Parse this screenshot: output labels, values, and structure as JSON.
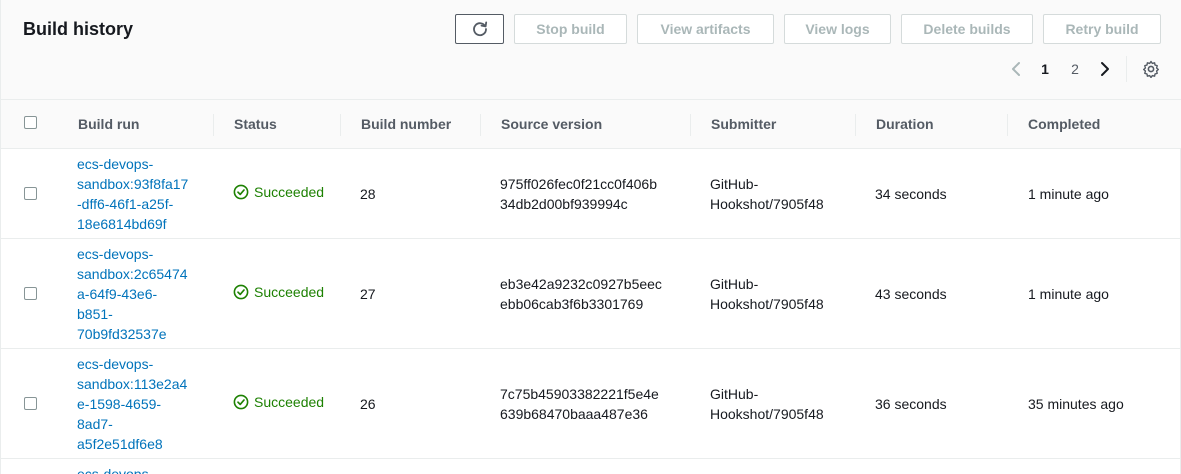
{
  "header": {
    "title": "Build history",
    "buttons": {
      "stop": "Stop build",
      "artifacts": "View artifacts",
      "logs": "View logs",
      "delete": "Delete builds",
      "retry": "Retry build"
    }
  },
  "pagination": {
    "pages": [
      "1",
      "2"
    ],
    "current": "1"
  },
  "table": {
    "columns": [
      "Build run",
      "Status",
      "Build number",
      "Source version",
      "Submitter",
      "Duration",
      "Completed"
    ],
    "rows": [
      {
        "build_run_lines": [
          "ecs-devops-",
          "sandbox:93f8fa17",
          "-dff6-46f1-a25f-",
          "18e6814bd69f"
        ],
        "status": "Succeeded",
        "build_number": "28",
        "source_version_lines": [
          "975ff026fec0f21cc0f406b",
          "34db2d00bf939994c"
        ],
        "submitter_lines": [
          "GitHub-",
          "Hookshot/7905f48"
        ],
        "duration": "34 seconds",
        "completed": "1 minute ago"
      },
      {
        "build_run_lines": [
          "ecs-devops-",
          "sandbox:2c65474",
          "a-64f9-43e6-",
          "b851-",
          "70b9fd32537e"
        ],
        "status": "Succeeded",
        "build_number": "27",
        "source_version_lines": [
          "eb3e42a9232c0927b5eec",
          "ebb06cab3f6b3301769"
        ],
        "submitter_lines": [
          "GitHub-",
          "Hookshot/7905f48"
        ],
        "duration": "43 seconds",
        "completed": "1 minute ago"
      },
      {
        "build_run_lines": [
          "ecs-devops-",
          "sandbox:113e2a4",
          "e-1598-4659-",
          "8ad7-",
          "a5f2e51df6e8"
        ],
        "status": "Succeeded",
        "build_number": "26",
        "source_version_lines": [
          "7c75b45903382221f5e4e",
          "639b68470baaa487e36"
        ],
        "submitter_lines": [
          "GitHub-",
          "Hookshot/7905f48"
        ],
        "duration": "36 seconds",
        "completed": "35 minutes ago"
      },
      {
        "build_run_lines": [
          "ecs-devops-"
        ]
      }
    ]
  },
  "colors": {
    "link": "#0073bb",
    "success": "#1d8102",
    "disabled_text": "#aab7b8",
    "header_bg": "#fafafa"
  },
  "icons": [
    "refresh-icon",
    "chevron-left-icon",
    "chevron-right-icon",
    "gear-icon",
    "check-circle-icon"
  ]
}
